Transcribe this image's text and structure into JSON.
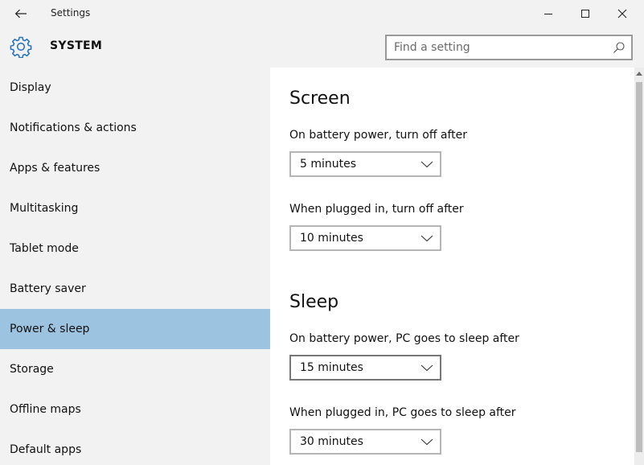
{
  "window": {
    "title": "Settings"
  },
  "header": {
    "section_title": "SYSTEM",
    "search_placeholder": "Find a setting",
    "search_value": ""
  },
  "sidebar": {
    "items": [
      {
        "label": "Display"
      },
      {
        "label": "Notifications & actions"
      },
      {
        "label": "Apps & features"
      },
      {
        "label": "Multitasking"
      },
      {
        "label": "Tablet mode"
      },
      {
        "label": "Battery saver"
      },
      {
        "label": "Power & sleep",
        "selected": true
      },
      {
        "label": "Storage"
      },
      {
        "label": "Offline maps"
      },
      {
        "label": "Default apps"
      }
    ]
  },
  "main": {
    "screen": {
      "title": "Screen",
      "battery_label": "On battery power, turn off after",
      "battery_value": "5 minutes",
      "plugged_label": "When plugged in, turn off after",
      "plugged_value": "10 minutes"
    },
    "sleep": {
      "title": "Sleep",
      "battery_label": "On battery power, PC goes to sleep after",
      "battery_value": "15 minutes",
      "plugged_label": "When plugged in, PC goes to sleep after",
      "plugged_value": "30 minutes"
    }
  },
  "colors": {
    "accent": "#2b75bd",
    "selected_nav": "#9cc3df",
    "chrome_background": "#f2f2f2"
  },
  "icons": {
    "back": "back-arrow-icon",
    "settings": "gear-icon",
    "search": "search-icon",
    "dropdown": "chevron-down-icon"
  }
}
